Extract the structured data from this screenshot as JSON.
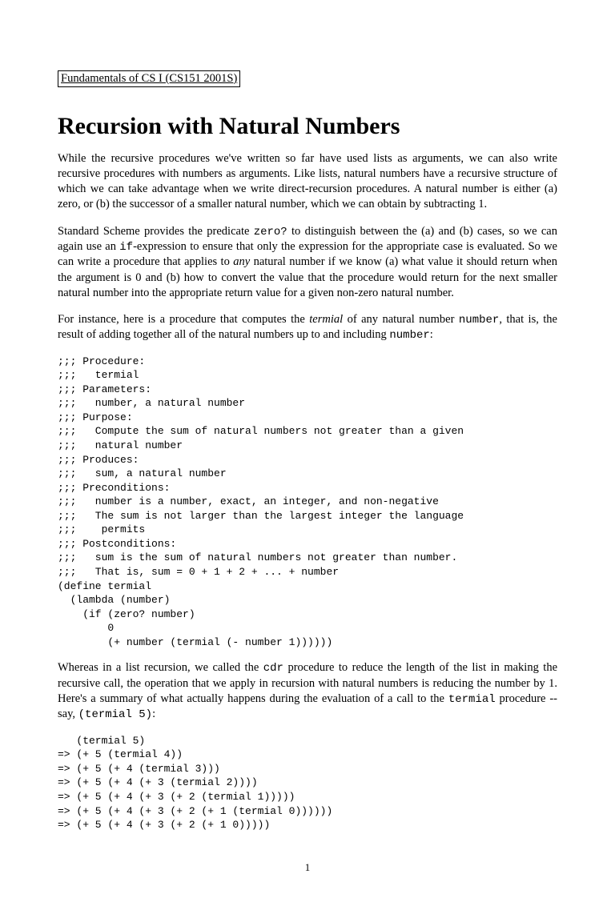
{
  "course_header": "Fundamentals of CS I (CS151 2001S)",
  "title": "Recursion with Natural Numbers",
  "para1": "While the recursive procedures we've written so far have used lists as arguments, we can also write recursive procedures with numbers as arguments. Like lists, natural numbers have a recursive structure of which we can take advantage when we write direct-recursion procedures. A natural number is either (a) zero, or (b) the successor of a smaller natural number, which we can obtain by subtracting 1.",
  "para2_a": "Standard Scheme provides the predicate ",
  "para2_code1": "zero?",
  "para2_b": " to distinguish between the (a) and (b) cases, so we can again use an ",
  "para2_code2": "if",
  "para2_c": "-expression to ensure that only the expression for the appropriate case is evaluated. So we can write a procedure that applies to ",
  "para2_italic": "any",
  "para2_d": " natural number if we know (a) what value it should return when the argument is 0 and (b) how to convert the value that the procedure would return for the next smaller natural number into the appropriate return value for a given non-zero natural number.",
  "para3_a": "For instance, here is a procedure that computes the ",
  "para3_italic": "termial",
  "para3_b": " of any natural number ",
  "para3_code1": "number",
  "para3_c": ", that is, the result of adding together all of the natural numbers up to and including ",
  "para3_code2": "number",
  "para3_d": ":",
  "codeblock1": ";;; Procedure:\n;;;   termial\n;;; Parameters:\n;;;   number, a natural number\n;;; Purpose:\n;;;   Compute the sum of natural numbers not greater than a given\n;;;   natural number\n;;; Produces:\n;;;   sum, a natural number\n;;; Preconditions:\n;;;   number is a number, exact, an integer, and non-negative\n;;;   The sum is not larger than the largest integer the language\n;;;    permits\n;;; Postconditions:\n;;;   sum is the sum of natural numbers not greater than number.\n;;;   That is, sum = 0 + 1 + 2 + ... + number\n(define termial\n  (lambda (number)\n    (if (zero? number)\n        0\n        (+ number (termial (- number 1))))))",
  "para4_a": "Whereas in a list recursion, we called the ",
  "para4_code1": "cdr",
  "para4_b": " procedure to reduce the length of the list in making the recursive call, the operation that we apply in recursion with natural numbers is reducing the number by 1. Here's a summary of what actually happens during the evaluation of a call to the ",
  "para4_code2": "termial",
  "para4_c": " procedure -- say, ",
  "para4_code3": "(termial 5)",
  "para4_d": ":",
  "codeblock2": "   (termial 5)\n=> (+ 5 (termial 4))\n=> (+ 5 (+ 4 (termial 3)))\n=> (+ 5 (+ 4 (+ 3 (termial 2))))\n=> (+ 5 (+ 4 (+ 3 (+ 2 (termial 1)))))\n=> (+ 5 (+ 4 (+ 3 (+ 2 (+ 1 (termial 0))))))\n=> (+ 5 (+ 4 (+ 3 (+ 2 (+ 1 0)))))",
  "page_num": "1"
}
